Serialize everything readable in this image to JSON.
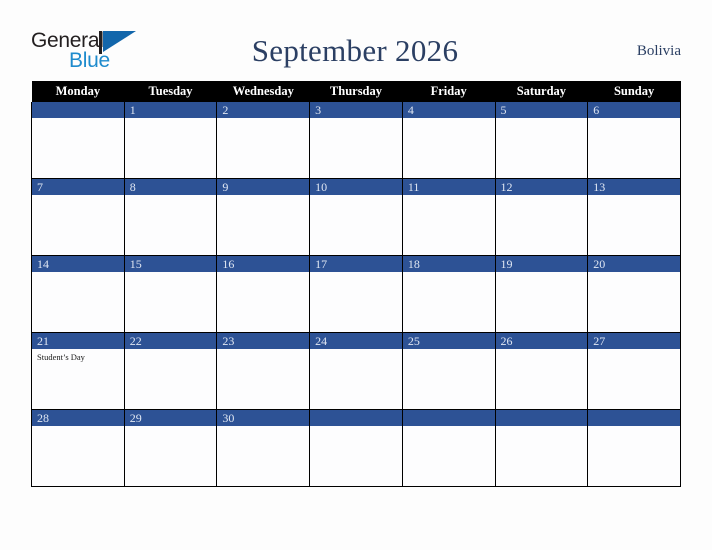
{
  "brand": {
    "name_part1": "General",
    "name_part2": "Blue",
    "flag_icon": "flag-triangle-icon",
    "accent_color": "#1266ab",
    "text_color": "#231f20"
  },
  "header": {
    "title": "September 2026",
    "country": "Bolivia",
    "title_color": "#2b3f63"
  },
  "calendar": {
    "month": "September",
    "year": "2026",
    "header_bg": "#000000",
    "daybar_bg": "#2d5295",
    "cell_bg": "#fdfdfe",
    "weekday_headers": [
      "Monday",
      "Tuesday",
      "Wednesday",
      "Thursday",
      "Friday",
      "Saturday",
      "Sunday"
    ],
    "weeks": [
      [
        {
          "day": "",
          "events": []
        },
        {
          "day": "1",
          "events": []
        },
        {
          "day": "2",
          "events": []
        },
        {
          "day": "3",
          "events": []
        },
        {
          "day": "4",
          "events": []
        },
        {
          "day": "5",
          "events": []
        },
        {
          "day": "6",
          "events": []
        }
      ],
      [
        {
          "day": "7",
          "events": []
        },
        {
          "day": "8",
          "events": []
        },
        {
          "day": "9",
          "events": []
        },
        {
          "day": "10",
          "events": []
        },
        {
          "day": "11",
          "events": []
        },
        {
          "day": "12",
          "events": []
        },
        {
          "day": "13",
          "events": []
        }
      ],
      [
        {
          "day": "14",
          "events": []
        },
        {
          "day": "15",
          "events": []
        },
        {
          "day": "16",
          "events": []
        },
        {
          "day": "17",
          "events": []
        },
        {
          "day": "18",
          "events": []
        },
        {
          "day": "19",
          "events": []
        },
        {
          "day": "20",
          "events": []
        }
      ],
      [
        {
          "day": "21",
          "events": [
            "Student’s Day"
          ]
        },
        {
          "day": "22",
          "events": []
        },
        {
          "day": "23",
          "events": []
        },
        {
          "day": "24",
          "events": []
        },
        {
          "day": "25",
          "events": []
        },
        {
          "day": "26",
          "events": []
        },
        {
          "day": "27",
          "events": []
        }
      ],
      [
        {
          "day": "28",
          "events": []
        },
        {
          "day": "29",
          "events": []
        },
        {
          "day": "30",
          "events": []
        },
        {
          "day": "",
          "events": []
        },
        {
          "day": "",
          "events": []
        },
        {
          "day": "",
          "events": []
        },
        {
          "day": "",
          "events": []
        }
      ]
    ]
  }
}
